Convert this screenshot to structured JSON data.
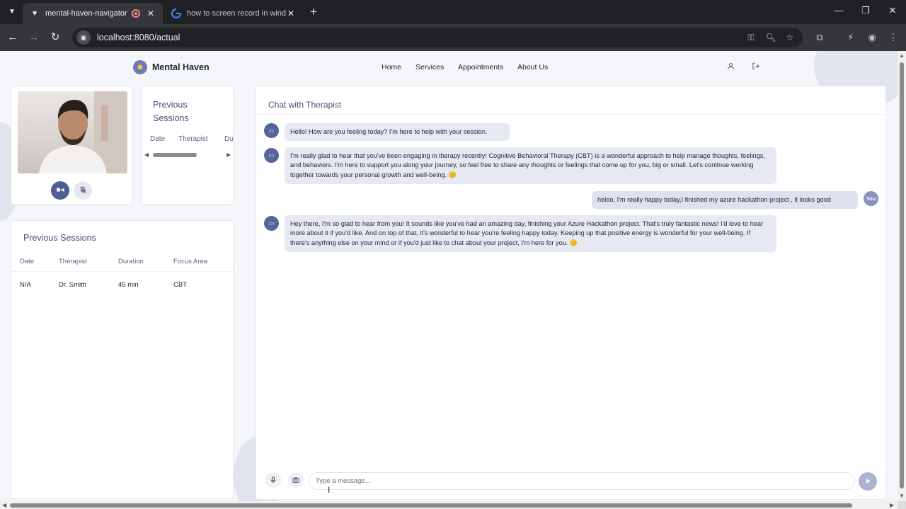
{
  "browser": {
    "tabs": [
      {
        "title": "mental-haven-navigator",
        "active": true,
        "recording": true
      },
      {
        "title": "how to screen record in window",
        "active": false
      }
    ],
    "url": "localhost:8080/actual"
  },
  "header": {
    "brand": "Mental Haven",
    "nav": [
      "Home",
      "Services",
      "Appointments",
      "About Us"
    ]
  },
  "sidebar": {
    "small_sessions": {
      "title": "Previous Sessions",
      "columns": [
        "Date",
        "Therapist",
        "Du"
      ]
    },
    "sessions": {
      "title": "Previous Sessions",
      "columns": [
        "Date",
        "Therapist",
        "Duration",
        "Focus Area"
      ],
      "rows": [
        {
          "date": "N/A",
          "therapist": "Dr. Smith",
          "duration": "45 min",
          "focus": "CBT"
        }
      ]
    }
  },
  "chat": {
    "title": "Chat with Therapist",
    "messages": [
      {
        "from": "therapist",
        "text": "Hello! How are you feeling today? I'm here to help with your session."
      },
      {
        "from": "therapist",
        "text": "I'm really glad to hear that you've been engaging in therapy recently! Cognitive Behavioral Therapy (CBT) is a wonderful approach to help manage thoughts, feelings, and behaviors. I'm here to support you along your journey, so feel free to share any thoughts or feelings that come up for you, big or small. Let's continue working together towards your personal growth and well-being. 😊"
      },
      {
        "from": "user",
        "text": "heloo, I'm really happy today,I finished my azure hackathon project , it looks good",
        "avatar_label": "You"
      },
      {
        "from": "therapist",
        "text": "Hey there, I'm so glad to hear from you! It sounds like you've had an amazing day, finishing your Azure Hackathon project. That's truly fantastic news! I'd love to hear more about it if you'd like. And on top of that, it's wonderful to hear you're feeling happy today. Keeping up that positive energy is wonderful for your well-being. If there's anything else on your mind or if you'd just like to chat about your project, I'm here for you. 😊"
      }
    ],
    "input_placeholder": "Type a message..."
  }
}
